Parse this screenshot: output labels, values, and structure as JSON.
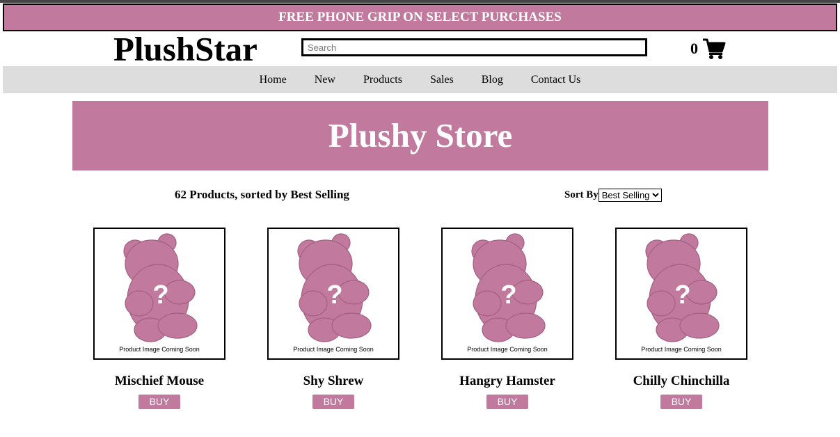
{
  "promo_banner": {
    "text": "FREE PHONE GRIP ON SELECT PURCHASES"
  },
  "header": {
    "logo": "PlushStar",
    "search_placeholder": "Search",
    "search_value": "",
    "cart_count": "0",
    "cart_icon": "shopping-cart-icon"
  },
  "nav": {
    "items": [
      {
        "label": "Home"
      },
      {
        "label": "New"
      },
      {
        "label": "Products"
      },
      {
        "label": "Sales"
      },
      {
        "label": "Blog"
      },
      {
        "label": "Contact Us"
      }
    ]
  },
  "hero": {
    "title": "Plushy Store"
  },
  "listing": {
    "count_text": "62 Products, sorted by Best Selling",
    "sort_label": "Sort By",
    "sort_selected": "Best Selling"
  },
  "products": [
    {
      "name": "Mischief Mouse",
      "image_caption": "Product Image Coming Soon",
      "image_icon": "bear-placeholder-icon",
      "buy_label": "BUY"
    },
    {
      "name": "Shy Shrew",
      "image_caption": "Product Image Coming Soon",
      "image_icon": "bear-placeholder-icon",
      "buy_label": "BUY"
    },
    {
      "name": "Hangry Hamster",
      "image_caption": "Product Image Coming Soon",
      "image_icon": "bear-placeholder-icon",
      "buy_label": "BUY"
    },
    {
      "name": "Chilly Chinchilla",
      "image_caption": "Product Image Coming Soon",
      "image_icon": "bear-placeholder-icon",
      "buy_label": "BUY"
    }
  ],
  "colors": {
    "accent": "#c17a9e",
    "nav_background": "#dddddd",
    "text": "#000000",
    "accent_text": "#ffffff"
  }
}
